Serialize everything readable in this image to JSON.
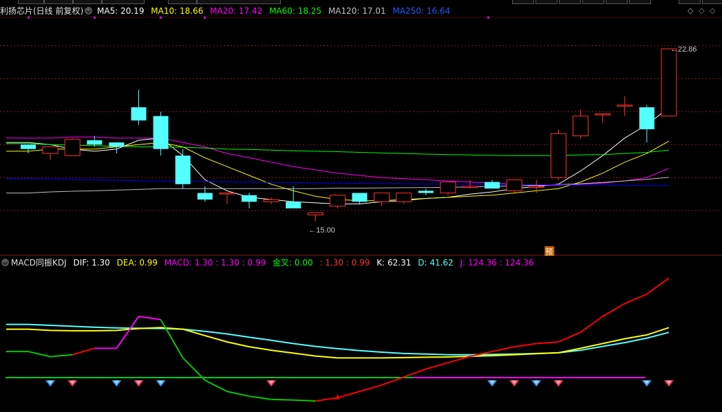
{
  "price_header": {
    "title": "利扬芯片(日线 前复权)",
    "ma5": {
      "label": "MA5:",
      "value": "20.19",
      "color": "#ffffff"
    },
    "ma10": {
      "label": "MA10:",
      "value": "18.66",
      "color": "#ffff00"
    },
    "ma20": {
      "label": "MA20:",
      "value": "17.42",
      "color": "#ff00ff"
    },
    "ma60": {
      "label": "MA60:",
      "value": "18.25",
      "color": "#00ff00"
    },
    "ma120": {
      "label": "MA120:",
      "value": "17.01",
      "color": "#c0c0c0"
    },
    "ma250": {
      "label": "MA250:",
      "value": "16.64",
      "color": "#0000ff"
    }
  },
  "indicator_header": {
    "title": "MACD同振KDJ",
    "dif": {
      "label": "DIF:",
      "value": "1.30"
    },
    "dea": {
      "label": "DEA:",
      "value": "0.99"
    },
    "macd": {
      "label": "MACD:",
      "value": "1.30 : 1.30 : 0.99"
    },
    "golden_cross": {
      "label": "金叉:",
      "value": "0.00"
    },
    "extra": {
      "value": ": 1.30 : 0.99"
    },
    "k": {
      "label": "K:",
      "value": "62.31"
    },
    "d": {
      "label": "D:",
      "value": "41.62"
    },
    "j": {
      "label": "J:",
      "value": "124.36 : 124.36"
    }
  },
  "colors": {
    "up": "#ff3232",
    "down": "#54ffff",
    "grid": "#8b1a1a",
    "dif": "#54ffff",
    "dea": "#ffff00",
    "kdj_j": "#ff0000",
    "kdj_mid": "#ff00ff",
    "kdj_low": "#00cc00",
    "zero_line": "#00cc00"
  },
  "chart_data": [
    {
      "type": "candlestick",
      "title": "利扬芯片(日线 前复权)",
      "ylim": [
        13.5,
        24.3
      ],
      "max_label": "22.86",
      "min_label": "15.00",
      "marker_label": "预",
      "ohlc": [
        {
          "o": 18.5,
          "h": 18.5,
          "l": 18.1,
          "c": 18.3
        },
        {
          "o": 18.1,
          "h": 18.3,
          "l": 17.8,
          "c": 18.4
        },
        {
          "o": 18.0,
          "h": 18.8,
          "l": 18.0,
          "c": 18.75
        },
        {
          "o": 18.7,
          "h": 18.9,
          "l": 18.4,
          "c": 18.5
        },
        {
          "o": 18.6,
          "h": 18.6,
          "l": 18.1,
          "c": 18.4
        },
        {
          "o": 20.2,
          "h": 21.0,
          "l": 19.4,
          "c": 19.6
        },
        {
          "o": 19.8,
          "h": 20.0,
          "l": 18.0,
          "c": 18.3
        },
        {
          "o": 18.0,
          "h": 18.3,
          "l": 16.5,
          "c": 16.7
        },
        {
          "o": 16.3,
          "h": 16.6,
          "l": 15.9,
          "c": 16.0
        },
        {
          "o": 16.3,
          "h": 16.3,
          "l": 15.8,
          "c": 16.3
        },
        {
          "o": 16.2,
          "h": 16.3,
          "l": 15.6,
          "c": 15.9
        },
        {
          "o": 15.9,
          "h": 16.1,
          "l": 15.8,
          "c": 16.0
        },
        {
          "o": 15.9,
          "h": 16.6,
          "l": 15.6,
          "c": 15.6
        },
        {
          "o": 15.3,
          "h": 15.4,
          "l": 15.0,
          "c": 15.4
        },
        {
          "o": 15.7,
          "h": 16.2,
          "l": 15.6,
          "c": 16.2
        },
        {
          "o": 16.3,
          "h": 16.3,
          "l": 15.8,
          "c": 15.9
        },
        {
          "o": 15.9,
          "h": 16.3,
          "l": 15.7,
          "c": 16.3
        },
        {
          "o": 15.9,
          "h": 16.3,
          "l": 15.8,
          "c": 16.3
        },
        {
          "o": 16.4,
          "h": 16.5,
          "l": 16.2,
          "c": 16.3
        },
        {
          "o": 16.3,
          "h": 16.8,
          "l": 16.2,
          "c": 16.8
        },
        {
          "o": 16.6,
          "h": 16.9,
          "l": 16.5,
          "c": 16.6
        },
        {
          "o": 16.8,
          "h": 16.9,
          "l": 16.5,
          "c": 16.5
        },
        {
          "o": 16.4,
          "h": 16.9,
          "l": 16.3,
          "c": 16.9
        },
        {
          "o": 16.6,
          "h": 16.9,
          "l": 16.3,
          "c": 16.6
        },
        {
          "o": 17.0,
          "h": 19.2,
          "l": 16.9,
          "c": 19.0
        },
        {
          "o": 18.9,
          "h": 20.1,
          "l": 18.8,
          "c": 19.8
        },
        {
          "o": 19.9,
          "h": 19.9,
          "l": 19.5,
          "c": 19.9
        },
        {
          "o": 20.3,
          "h": 20.7,
          "l": 19.8,
          "c": 20.3
        },
        {
          "o": 20.2,
          "h": 20.3,
          "l": 18.6,
          "c": 19.2
        },
        {
          "o": 19.8,
          "h": 22.86,
          "l": 19.8,
          "c": 22.86
        }
      ],
      "ma": [
        {
          "name": "MA5",
          "color": "#ffffff",
          "values": [
            18.6,
            18.5,
            18.3,
            18.2,
            18.3,
            18.7,
            18.8,
            18.0,
            16.9,
            16.4,
            16.1,
            16.0,
            15.9,
            15.85,
            15.8,
            15.8,
            15.9,
            15.95,
            16.05,
            16.1,
            16.25,
            16.35,
            16.5,
            16.6,
            16.7,
            17.3,
            18.0,
            18.8,
            19.4,
            20.19
          ]
        },
        {
          "name": "MA10",
          "color": "#ffff00",
          "values": [
            18.2,
            18.3,
            18.3,
            18.3,
            18.4,
            18.5,
            18.6,
            18.4,
            17.9,
            17.5,
            17.1,
            16.7,
            16.4,
            16.15,
            16.0,
            15.95,
            15.95,
            16.0,
            16.05,
            16.1,
            16.15,
            16.2,
            16.3,
            16.4,
            16.5,
            16.8,
            17.2,
            17.7,
            18.1,
            18.66
          ]
        },
        {
          "name": "MA20",
          "color": "#ff00ff",
          "values": [
            18.8,
            18.8,
            18.85,
            18.85,
            18.8,
            18.8,
            18.8,
            18.6,
            18.4,
            18.1,
            17.9,
            17.7,
            17.5,
            17.35,
            17.2,
            17.1,
            17.0,
            16.95,
            16.9,
            16.85,
            16.8,
            16.75,
            16.7,
            16.65,
            16.65,
            16.7,
            16.75,
            16.85,
            17.0,
            17.42
          ]
        },
        {
          "name": "MA60",
          "color": "#00ff00",
          "values": [
            18.55,
            18.5,
            18.48,
            18.45,
            18.42,
            18.4,
            18.4,
            18.38,
            18.35,
            18.3,
            18.28,
            18.25,
            18.22,
            18.2,
            18.18,
            18.15,
            18.12,
            18.1,
            18.07,
            18.05,
            18.03,
            18.01,
            18.0,
            18.0,
            18.01,
            18.03,
            18.05,
            18.1,
            18.15,
            18.25
          ]
        },
        {
          "name": "MA120",
          "color": "#c0c0c0",
          "values": [
            16.3,
            16.35,
            16.38,
            16.4,
            16.43,
            16.46,
            16.5,
            16.5,
            16.5,
            16.5,
            16.5,
            16.5,
            16.5,
            16.5,
            16.52,
            16.52,
            16.53,
            16.54,
            16.55,
            16.56,
            16.57,
            16.6,
            16.62,
            16.65,
            16.68,
            16.72,
            16.78,
            16.85,
            16.92,
            17.01
          ]
        },
        {
          "name": "MA250",
          "color": "#0000ff",
          "values": [
            16.96,
            16.94,
            16.92,
            16.9,
            16.88,
            16.86,
            16.85,
            16.84,
            16.82,
            16.8,
            16.79,
            16.78,
            16.77,
            16.76,
            16.75,
            16.74,
            16.73,
            16.72,
            16.71,
            16.7,
            16.7,
            16.69,
            16.68,
            16.68,
            16.67,
            16.66,
            16.66,
            16.65,
            16.64,
            16.64
          ]
        }
      ]
    },
    {
      "type": "line",
      "title": "MACD同振KDJ",
      "ylim": [
        -1.0,
        3.2
      ],
      "series": [
        {
          "name": "DIF",
          "color": "#54ffff",
          "values": [
            1.55,
            1.52,
            1.49,
            1.46,
            1.44,
            1.43,
            1.42,
            1.4,
            1.33,
            1.25,
            1.15,
            1.05,
            0.95,
            0.86,
            0.79,
            0.73,
            0.68,
            0.64,
            0.62,
            0.6,
            0.6,
            0.61,
            0.62,
            0.64,
            0.66,
            0.74,
            0.86,
            0.98,
            1.12,
            1.3
          ]
        },
        {
          "name": "DEA",
          "color": "#ffff00",
          "values": [
            1.4,
            1.36,
            1.35,
            1.35,
            1.36,
            1.42,
            1.45,
            1.4,
            1.2,
            1.0,
            0.85,
            0.74,
            0.65,
            0.56,
            0.5,
            0.5,
            0.5,
            0.51,
            0.52,
            0.53,
            0.55,
            0.57,
            0.6,
            0.63,
            0.66,
            0.8,
            0.95,
            1.1,
            1.22,
            1.45
          ]
        },
        {
          "name": "J",
          "color": "#ff0000",
          "values": [
            0.7,
            0.54,
            0.6,
            0.8,
            0.8,
            1.8,
            1.7,
            0.5,
            -0.2,
            -0.55,
            -0.7,
            -0.8,
            -0.82,
            -0.85,
            -0.75,
            -0.55,
            -0.35,
            -0.1,
            0.15,
            0.35,
            0.55,
            0.7,
            0.85,
            0.95,
            1.0,
            1.3,
            1.8,
            2.2,
            2.5,
            3.0
          ]
        }
      ],
      "markers_up": [
        1,
        4,
        6,
        21,
        23,
        28
      ],
      "markers_down": [
        2,
        5,
        11,
        22,
        24,
        29
      ]
    }
  ]
}
